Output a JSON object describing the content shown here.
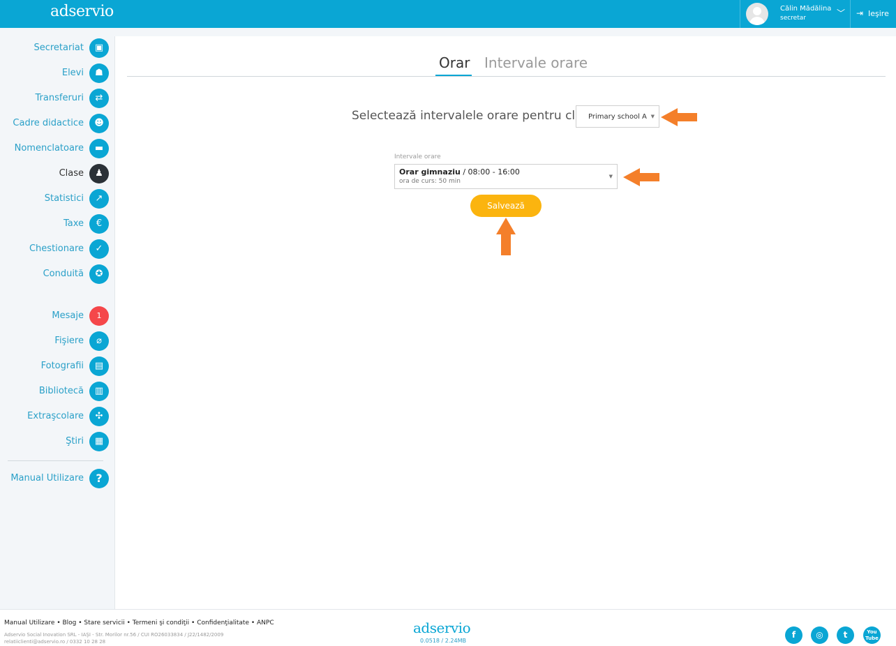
{
  "header": {
    "logo": "adservio",
    "user_name": "Călin Mădălina",
    "user_role": "secretar",
    "logout_label": "Ieşire"
  },
  "sidebar": {
    "items": [
      {
        "label": "Secretariat",
        "icon": "id-badge-icon"
      },
      {
        "label": "Elevi",
        "icon": "graduate-icon"
      },
      {
        "label": "Transferuri",
        "icon": "transfer-arrows-icon"
      },
      {
        "label": "Cadre didactice",
        "icon": "teacher-icon"
      },
      {
        "label": "Nomenclatoare",
        "icon": "list-icon"
      },
      {
        "label": "Clase",
        "icon": "classroom-icon"
      },
      {
        "label": "Statistici",
        "icon": "chart-line-icon"
      },
      {
        "label": "Taxe",
        "icon": "euro-icon"
      },
      {
        "label": "Chestionare",
        "icon": "checklist-icon"
      },
      {
        "label": "Conduită",
        "icon": "medal-icon"
      },
      {
        "label": "Mesaje",
        "icon": "message-badge",
        "badge": "1"
      },
      {
        "label": "Fişiere",
        "icon": "paperclip-icon"
      },
      {
        "label": "Fotografii",
        "icon": "photos-icon"
      },
      {
        "label": "Bibliotecă",
        "icon": "books-icon"
      },
      {
        "label": "Extraşcolare",
        "icon": "activities-icon"
      },
      {
        "label": "Ştiri",
        "icon": "news-icon"
      },
      {
        "label": "Manual Utilizare",
        "icon": "help-icon"
      }
    ],
    "active": "Clase"
  },
  "tabs": {
    "orar": "Orar",
    "intervale": "Intervale orare"
  },
  "form": {
    "select_prompt": "Selectează intervalele orare pentru clasa",
    "class_value": "Primary school A",
    "intervals_label": "Intervale orare",
    "interval_name": "Orar gimnaziu",
    "interval_range": " / 08:00 - 16:00",
    "interval_sub": "ora de curs: 50 min",
    "save_label": "Salvează"
  },
  "footer": {
    "links": "Manual Utilizare • Blog • Stare servicii • Termeni şi condiţii • Confidenţialitate • ANPC",
    "company": "Adservio Social Inovation SRL - IAŞI - Str. Morilor nr.56 / CUI RO26033834 / J22/1482/2009",
    "contact": "relatiiclienti@adservio.ro / 0332 10 28 28",
    "logo": "adservio",
    "version": "0.0518 / 2.24MB",
    "social": [
      "f",
      "◎",
      "t",
      "You Tube"
    ]
  },
  "colors": {
    "brand": "#0aa6d4",
    "accent_button": "#fbb40f",
    "annotation_arrow": "#f47f2a",
    "badge": "#f5474a"
  }
}
